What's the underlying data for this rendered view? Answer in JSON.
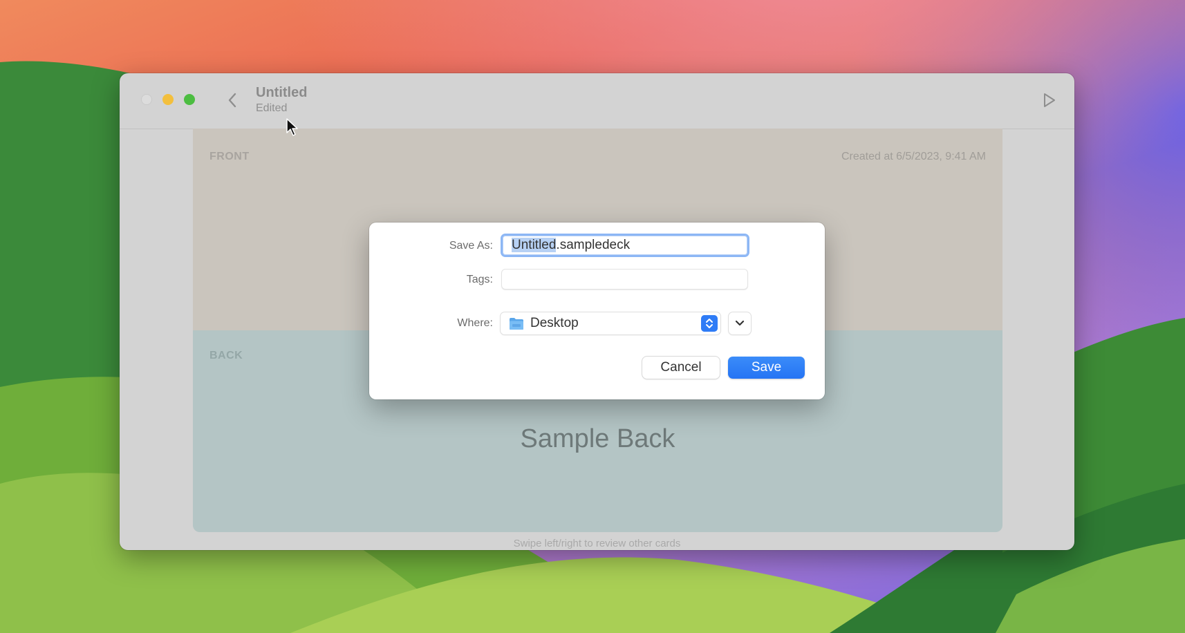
{
  "window": {
    "title": "Untitled",
    "subtitle": "Edited"
  },
  "card": {
    "front_label": "FRONT",
    "created": "Created at 6/5/2023, 9:41 AM",
    "back_label": "BACK",
    "back_text": "Sample Back",
    "hint": "Swipe left/right to review other cards"
  },
  "dialog": {
    "save_as_label": "Save As:",
    "save_as_selected": "Untitled",
    "save_as_rest": ".sampledeck",
    "tags_label": "Tags:",
    "tags_value": "",
    "where_label": "Where:",
    "where_value": "Desktop",
    "cancel_label": "Cancel",
    "save_label": "Save"
  },
  "colors": {
    "accent": "#2f7cf6",
    "traffic_min": "#f3bf3d",
    "traffic_zoom": "#4cbd41"
  },
  "icons": [
    "back-chevron-icon",
    "play-icon",
    "folder-icon",
    "stepper-icon",
    "chevron-down-icon",
    "cursor-icon"
  ]
}
